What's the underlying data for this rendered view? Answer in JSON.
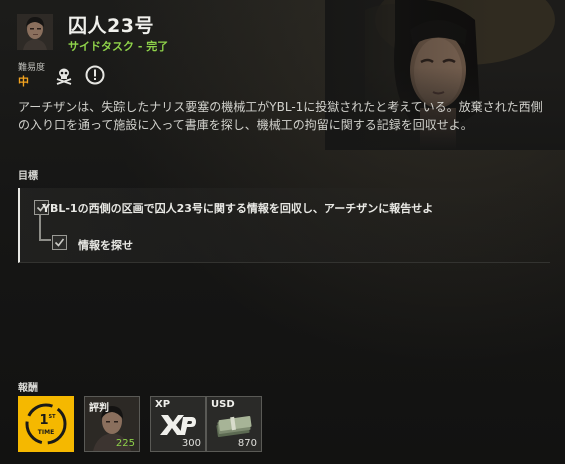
{
  "header": {
    "title": "囚人23号",
    "subtitle": "サイドタスク - 完了"
  },
  "difficulty": {
    "label": "難易度",
    "value": "中",
    "badges": [
      "skull-icon",
      "exclamation-icon"
    ]
  },
  "description": "アーチザンは、失踪したナリス要塞の機械工がYBL-1に投獄されたと考えている。放棄された西側の入り口を通って施設に入って書庫を探し、機械工の拘留に関する記録を回収せよ。",
  "objectives": {
    "label": "目標",
    "main": "YBL-1の西側の区画で囚人23号に関する情報を回収し、アーチザンに報告せよ",
    "sub": "情報を探せ"
  },
  "rewards": {
    "label": "報酬",
    "items": [
      {
        "icon": "first-time-icon",
        "label": "",
        "value": ""
      },
      {
        "icon": "reputation-portrait-icon",
        "label": "評判",
        "value": "225"
      },
      {
        "icon": "xp-icon",
        "label": "XP",
        "value": "300"
      },
      {
        "icon": "cash-icon",
        "label": "USD",
        "value": "870"
      }
    ]
  },
  "colors": {
    "complete_green": "#8fd34a",
    "difficulty_orange": "#f2a31f",
    "first_time_yellow": "#f5b800"
  }
}
